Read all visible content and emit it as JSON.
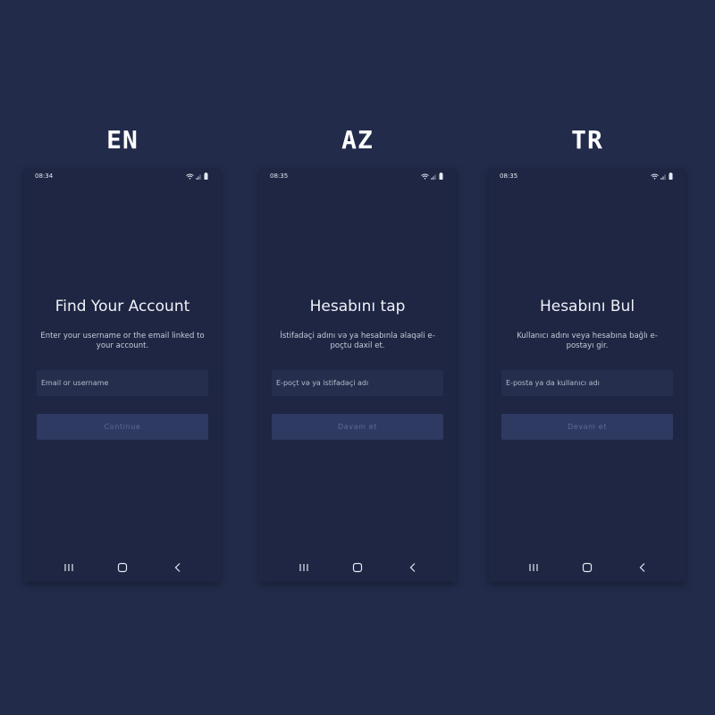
{
  "panels": [
    {
      "label": "EN",
      "time": "08:34",
      "title": "Find Your Account",
      "subtitle": "Enter your username or the email linked to your account.",
      "input_placeholder": "Email or username",
      "button": "Continue"
    },
    {
      "label": "AZ",
      "time": "08:35",
      "title": "Hesabını tap",
      "subtitle": "İstifadəçi adını və ya hesabınla əlaqəli e-poçtu daxil et.",
      "input_placeholder": "E-poçt və ya istifadəçi adı",
      "button": "Davam et"
    },
    {
      "label": "TR",
      "time": "08:35",
      "title": "Hesabını Bul",
      "subtitle": "Kullanıcı adını veya hesabına bağlı e-postayı gir.",
      "input_placeholder": "E-posta ya da kullanıcı adı",
      "button": "Devam et"
    }
  ],
  "colors": {
    "background": "#222b4a",
    "screen": "#1e2643",
    "input": "#252e4d",
    "button": "#2e3a61",
    "button_text": "#5d6a92"
  },
  "icons": {
    "status": [
      "wifi-icon",
      "signal-icon",
      "battery-icon"
    ],
    "navigation": [
      "recent-apps-icon",
      "home-icon",
      "back-icon"
    ]
  }
}
